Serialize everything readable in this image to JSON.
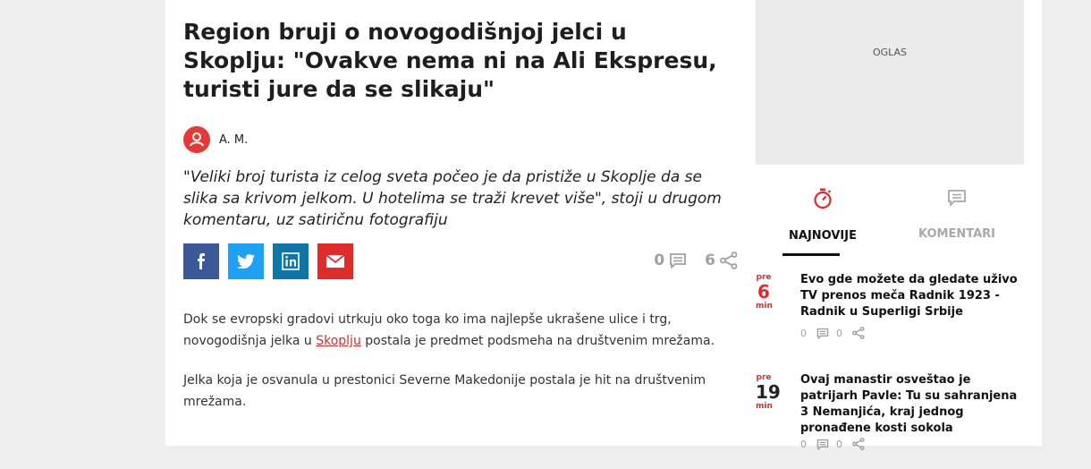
{
  "article": {
    "title": "Region bruji o novogodišnjoj jelci u Skoplju: \"Ovakve nema ni na Ali Ekspresu, turisti jure da se slikaju\"",
    "author": "A. M.",
    "lead": "\"Veliki broj turista iz celog sveta počeo je da pristiže u Skoplje da se slika sa krivom jelkom. U hotelima se traži krevet više\", stoji u drugom komentaru, uz satiričnu fotografiju",
    "share": {
      "facebook_icon": "facebook-icon",
      "twitter_icon": "twitter-icon",
      "linkedin_icon": "linkedin-icon",
      "email_icon": "email-icon"
    },
    "comment_count": "0",
    "share_count": "6",
    "paragraph1_before": "Dok se evropski gradovi utrkuju oko toga ko ima najlepše ukrašene ulice i trg, novogodišnja jelka u ",
    "paragraph1_link": "Skoplju",
    "paragraph1_after": " postala je predmet podsmeha na društvenim mrežama.",
    "paragraph2": "Jelka koja je osvanula u prestonici Severne Makedonije postala je hit na društvenim mrežama."
  },
  "sidebar": {
    "ad_label": "OGLAS",
    "tabs": [
      {
        "label": "NAJNOVIJE",
        "icon": "stopwatch-icon"
      },
      {
        "label": "KOMENTARI",
        "icon": "comment-icon"
      }
    ],
    "news": [
      {
        "time_prefix": "pre",
        "time_value": "6",
        "time_unit": "min",
        "title": "Evo gde možete da gledate uživo TV prenos meča Radnik 1923 - Radnik u Superligi Srbije",
        "comments": "0",
        "shares": "0"
      },
      {
        "time_prefix": "pre",
        "time_value": "19",
        "time_unit": "min",
        "title": "Ovaj manastir osveštao je patrijarh Pavle: Tu su sahranjena 3 Nemanjića, kraj jednog pronađene kosti sokola",
        "comments": "0",
        "shares": "0"
      }
    ]
  },
  "colors": {
    "accent": "#e02b2b",
    "facebook": "#3b5998",
    "twitter": "#1da1f2",
    "linkedin": "#0e76a8",
    "email": "#e02b2b"
  }
}
